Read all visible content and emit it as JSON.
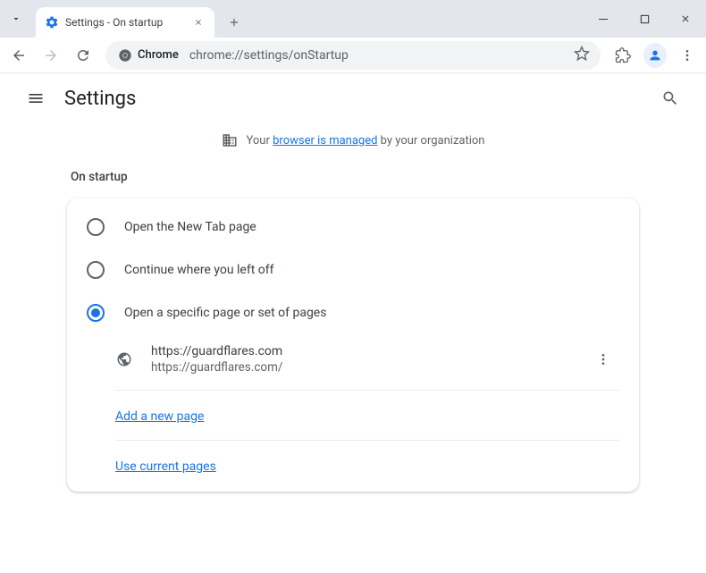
{
  "titlebar": {
    "tab_title": "Settings - On startup"
  },
  "toolbar": {
    "chrome_label": "Chrome",
    "url": "chrome://settings/onStartup"
  },
  "header": {
    "title": "Settings"
  },
  "managed": {
    "prefix": "Your ",
    "link": "browser is managed",
    "suffix": " by your organization"
  },
  "section": {
    "label": "On startup",
    "options": [
      {
        "label": "Open the New Tab page",
        "selected": false
      },
      {
        "label": "Continue where you left off",
        "selected": false
      },
      {
        "label": "Open a specific page or set of pages",
        "selected": true
      }
    ],
    "page": {
      "title": "https://guardflares.com",
      "url": "https://guardflares.com/"
    },
    "add_page": "Add a new page",
    "use_current": "Use current pages"
  }
}
